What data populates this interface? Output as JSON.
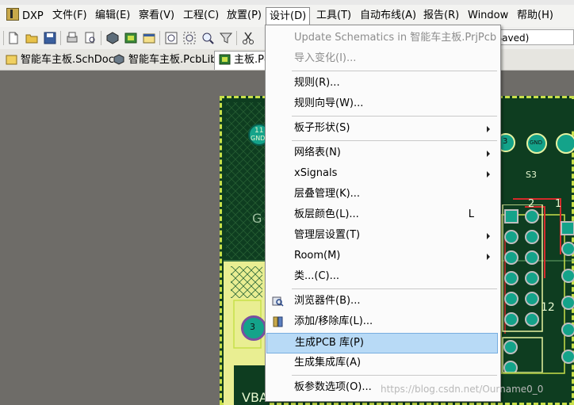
{
  "menubar": {
    "items": [
      "DXP",
      "文件(F)",
      "编辑(E)",
      "察看(V)",
      "工程(C)",
      "放置(P)",
      "设计(D)",
      "工具(T)",
      "自动布线(A)",
      "报告(R)",
      "Window",
      "帮助(H)"
    ]
  },
  "toolbar": {
    "combo_value": "t Saved)"
  },
  "tabs": [
    "智能车主板.SchDoc",
    "智能车主板.PcbLib",
    "主板.Pc"
  ],
  "board": {
    "labels": [
      "11",
      "GND",
      "G",
      "3",
      "3",
      "GND",
      "S3",
      "2",
      "1",
      "12",
      "VBAT"
    ]
  },
  "dropdown": {
    "items": [
      {
        "label": "Update Schematics in 智能车主板.PrjPcb",
        "disabled": true
      },
      {
        "label": "导入变化(I)...",
        "disabled": true
      },
      {
        "label": "规则(R)..."
      },
      {
        "label": "规则向导(W)..."
      },
      {
        "label": "板子形状(S)"
      },
      {
        "label": "网络表(N)"
      },
      {
        "label": "xSignals"
      },
      {
        "label": "层叠管理(K)..."
      },
      {
        "label": "板层颜色(L)...",
        "shortcut": "L"
      },
      {
        "label": "管理层设置(T)"
      },
      {
        "label": "Room(M)"
      },
      {
        "label": "类...(C)..."
      },
      {
        "label": "浏览器件(B)..."
      },
      {
        "label": "添加/移除库(L)..."
      },
      {
        "label": "生成PCB 库(P)"
      },
      {
        "label": "生成集成库(A)"
      },
      {
        "label": "板参数选项(O)..."
      }
    ]
  },
  "watermark": "https://blog.csdn.net/Ourname0_0",
  "colors": {
    "highlight": "#b8daf6",
    "board": "#0e3d20",
    "board_outline": "#c8e04a",
    "pad": "#14a38a"
  }
}
